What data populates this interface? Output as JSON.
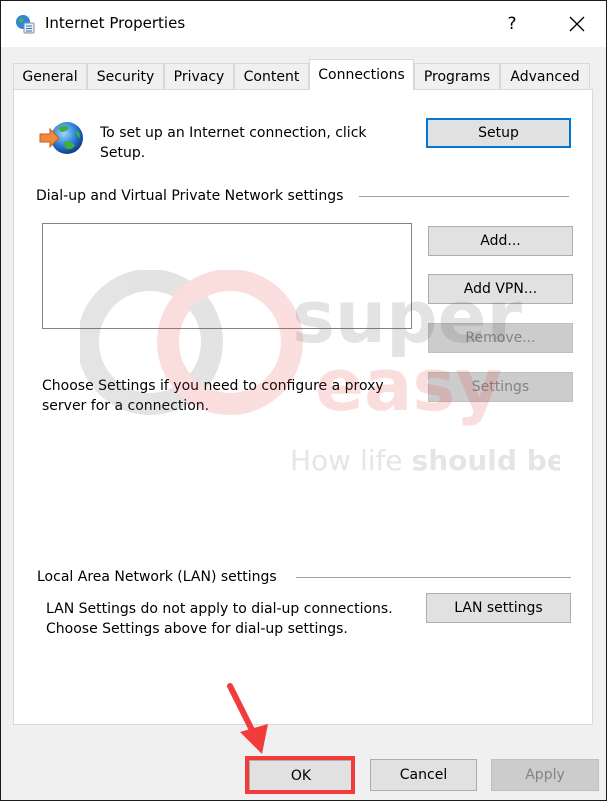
{
  "window": {
    "title": "Internet Properties",
    "help_label": "?",
    "icons": {
      "app": "internet-options-icon",
      "close": "close-icon"
    }
  },
  "tabs": [
    {
      "label": "General",
      "active": false
    },
    {
      "label": "Security",
      "active": false
    },
    {
      "label": "Privacy",
      "active": false
    },
    {
      "label": "Content",
      "active": false
    },
    {
      "label": "Connections",
      "active": true
    },
    {
      "label": "Programs",
      "active": false
    },
    {
      "label": "Advanced",
      "active": false
    }
  ],
  "connections": {
    "setup_text_line1": "To set up an Internet connection, click",
    "setup_text_line2": "Setup.",
    "setup_button": "Setup",
    "dialup_group_label": "Dial-up and Virtual Private Network settings",
    "dialup_list_items": [],
    "add_button": "Add...",
    "add_vpn_button": "Add VPN...",
    "remove_button": "Remove...",
    "settings_button": "Settings",
    "proxy_text_line1": "Choose Settings if you need to configure a proxy",
    "proxy_text_line2": "server for a connection.",
    "lan_group_label": "Local Area Network (LAN) settings",
    "lan_text_line1": "LAN Settings do not apply to dial-up connections.",
    "lan_text_line2": "Choose Settings above for dial-up settings.",
    "lan_settings_button": "LAN settings"
  },
  "footer": {
    "ok_button": "OK",
    "cancel_button": "Cancel",
    "apply_button": "Apply"
  },
  "watermark": {
    "brand_line1": "super",
    "brand_line2": "easy",
    "tagline_light": "How life ",
    "tagline_bold": "should be"
  },
  "annotation": {
    "highlight_color": "#f23b3b",
    "target": "OK"
  },
  "colors": {
    "default_button_border": "#0078d7",
    "disabled_text": "#838383"
  }
}
